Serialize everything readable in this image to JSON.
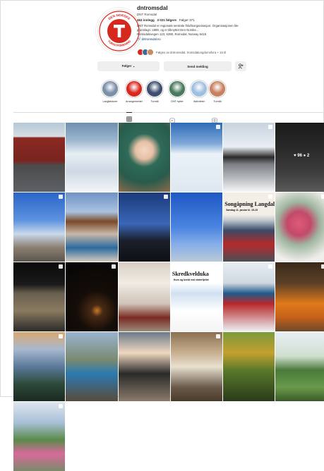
{
  "profile": {
    "username": "dntromsdal",
    "category": "DNT Romsdal",
    "stats": {
      "posts": "463 innlegg",
      "followers": "3 021 følgere",
      "following": "Følger 371"
    },
    "bio_lines": [
      "DNT Romsdal er regionale sentrale friluftsorganisasjon. Organisasjonen ble",
      "grunnlagt i 1889, og er tilknyttet Den Norske...",
      "Romsdalsvegen 123, 6390, Romsdal, Norway 6415"
    ],
    "link": "dntromsdal.no",
    "followed_by": "Følges av dntromsdal, tromsdalungdomsfora + 16 til",
    "logo_text_top": "DEN NORSKE",
    "logo_text_bottom": "TURISTFORENING"
  },
  "actions": {
    "following_label": "Følger ⌄",
    "message_label": "Send melding",
    "more_icon": "add-person-icon"
  },
  "highlights": [
    {
      "label": "Langtidsturer",
      "color": "#7a8fa8"
    },
    {
      "label": "Arrangementer",
      "color": "#d7281e"
    },
    {
      "label": "Turmål",
      "color": "#3d4e6e"
    },
    {
      "label": "DNT hytter",
      "color": "#4a7a5e"
    },
    {
      "label": "Aktiviteter",
      "color": "#9fc0e0"
    },
    {
      "label": "Turmål",
      "color": "#c88060"
    }
  ],
  "tabs": [
    "grid-icon",
    "reels-icon",
    "tagged-icon"
  ],
  "posts": [
    {
      "name": "post-red-cabin",
      "bg": "linear-gradient(#b4c8d8 0%, #d8dde2 20%, #8a2a22 22%, #7a2420 55%, #4b4b4b 62%, #5d6165 100%)",
      "badge": false
    },
    {
      "name": "post-snow-valley",
      "bg": "linear-gradient(#6f8fb0 0%, #9bb6cf 25%, #e8eef4 45%, #cfd9e4 70%, #f2f5f8 100%)",
      "badge": false
    },
    {
      "name": "post-woman-mug",
      "bg": "radial-gradient(circle at 50% 40%, #f4d6c2 0%, #e7c0a5 18%, #2f6a58 34%, #285b4c 65%, #8c6b4c 100%)",
      "badge": false
    },
    {
      "name": "post-snow-cave",
      "bg": "linear-gradient(#2e6bb6 0%, #7fa8d8 30%, #eaf1f8 45%, #dfe7f0 100%)",
      "badge": true
    },
    {
      "name": "post-skiers-forest",
      "bg": "linear-gradient(#c7d3df 0%, #e9eef3 35%, #2a2a2a 50%, #7b7f84 60%, #f4f6f8 100%)",
      "badge": true
    },
    {
      "name": "post-night-group",
      "bg": "linear-gradient(#1a1a1a 0%, #2b2b2b 40%, #3c3c3c 70%, #5a5a5a 100%)",
      "badge": false,
      "stat": "♥ 96  ● 2"
    },
    {
      "name": "post-mountain-group",
      "bg": "linear-gradient(#2a65c8 0%, #5c92e0 40%, #c9d9ea 60%, #8a7e70 80%, #5c5650 100%)",
      "badge": true
    },
    {
      "name": "post-cabin-crowd",
      "bg": "linear-gradient(#6e93c6 0%, #a9c2e0 28%, #7a4a2a 42%, #c8b8a8 60%, #2b6a9e 80%, #d4c8bc 100%)",
      "badge": false
    },
    {
      "name": "post-night-cabin",
      "bg": "linear-gradient(#1b3a7a 0%, #3a66b8 45%, #1a1f2a 70%, #0d0f14 100%)",
      "badge": true
    },
    {
      "name": "post-climber-sky",
      "bg": "linear-gradient(#1d57c4 0%, #4a84e0 50%, #86aee8 75%, #b9c9d9 100%)",
      "badge": false
    },
    {
      "name": "post-songoppning",
      "bg": "linear-gradient(#f4efe6 0%, #f4efe6 32%, #c0c8d0 40%, #3a4a66 55%, #b62a2a 75%, #4a4e56 100%)",
      "badge": true,
      "overlay": "Songåpning Langdal",
      "overlay_sub": "Søndag 11. januar kl. 15-15"
    },
    {
      "name": "post-heather",
      "bg": "radial-gradient(circle at 45% 45%, #e05a78 0%, #c24a6a 25%, #9fb5a0 45%, #f0eeea 80%)",
      "badge": true
    },
    {
      "name": "post-cabin-interior",
      "bg": "linear-gradient(#0a0a0a 0%, #1a1a1a 32%, #6a6050 45%, #8a7a60 70%, #2a2a2a 100%)",
      "badge": true
    },
    {
      "name": "post-candle-night",
      "bg": "radial-gradient(circle at 60% 70%, #c97a2a 0%, #4a2a14 10%, #140d08 35%, #050505 100%)",
      "badge": true
    },
    {
      "name": "post-mountain-hut",
      "bg": "linear-gradient(#d8d0c4 0%, #f0ebe4 30%, #cfc4b6 60%, #7a2a22 80%, #9a8a7a 100%)",
      "badge": false
    },
    {
      "name": "post-skredkveld",
      "bg": "linear-gradient(#ffffff 0%, #ffffff 30%, #cfe0f2 45%, #ffffff 70%, #f4f4f4 100%)",
      "badge": false,
      "overlay": "Skredkvelduka",
      "overlay_sub": "Kurs og kveld ved vinterfjellet"
    },
    {
      "name": "post-ski-group",
      "bg": "linear-gradient(#e8edf2 0%, #cfd8e2 30%, #1f5a8a 45%, #b8282a 60%, #ecf0f4 100%)",
      "badge": true
    },
    {
      "name": "post-pumpkins",
      "bg": "linear-gradient(#3a2a1a 0%, #5a4028 30%, #e07a1a 60%, #c4601a 80%, #6a4a2a 100%)",
      "badge": true
    },
    {
      "name": "post-coast-sunset",
      "bg": "linear-gradient(#d8a870 0%, #a8b8d0 25%, #5a7a9a 50%, #2e4a3a 75%, #1a2a20 100%)",
      "badge": true
    },
    {
      "name": "post-friends-hike",
      "bg": "linear-gradient(#9ab4d0 0%, #7a8a70 40%, #2a7ab0 60%, #5a4a3a 100%)",
      "badge": false
    },
    {
      "name": "post-kids-cabin",
      "bg": "linear-gradient(#6a7a8a 0%, #f0d8c0 30%, #2a2a2a 60%, #8a7a6a 100%)",
      "badge": false
    },
    {
      "name": "post-coffee-stove",
      "bg": "linear-gradient(#8a7050 0%, #c8b090 30%, #e8e0d0 50%, #6a5a4a 80%, #4a3a2a 100%)",
      "badge": true
    },
    {
      "name": "post-autumn-forest",
      "bg": "linear-gradient(#7a9a3a 0%, #c4a030 30%, #5a7a2a 55%, #2a3a1a 100%)",
      "badge": false
    },
    {
      "name": "post-meadow-group",
      "bg": "linear-gradient(#e8eef4 0%, #cfdfcf 35%, #4a7a3a 55%, #6a9a4a 80%, #3a5a2a 100%)",
      "badge": false
    },
    {
      "name": "post-field-group",
      "bg": "linear-gradient(#dfe6ee 0%, #a8c0d8 30%, #5a8a4a 55%, #d86a9a 75%, #7a8a6a 100%)",
      "badge": true
    }
  ]
}
